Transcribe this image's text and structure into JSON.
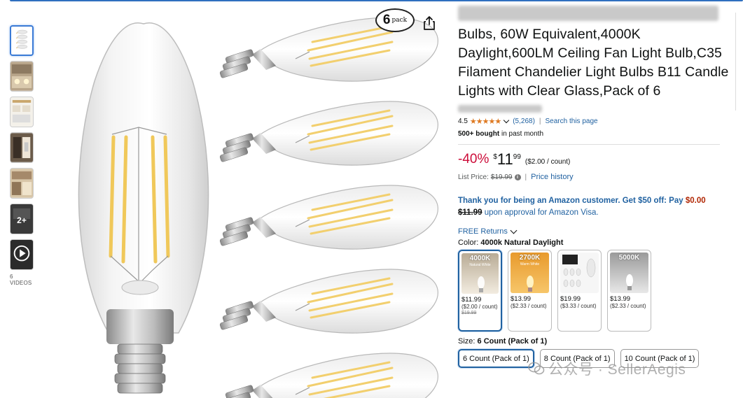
{
  "product": {
    "title": "Bulbs, 60W Equivalent,4000K Daylight,600LM Ceiling Fan Light Bulb,C35 Filament Chandelier Light Bulbs B11 Candle Lights with Clear Glass,Pack of 6",
    "rating_value": "4.5",
    "rating_stars": "★★★★★",
    "rating_count": "(5,268)",
    "search_page_link": "Search this page",
    "bought_count": "500+ bought",
    "bought_suffix": " in past month",
    "discount": "-40%",
    "currency": "$",
    "price_whole": "11",
    "price_fraction": "99",
    "unit_price": "($2.00 / count)",
    "list_price_label": "List Price:",
    "list_price": "$19.99",
    "price_history_link": "Price history",
    "pack_badge_number": "6",
    "pack_badge_text": "pack"
  },
  "promo": {
    "text_bold": "Thank you for being an Amazon customer. Get $50 off: Pay",
    "pay_amount": "$0.00",
    "original": "$11.99",
    "suffix": " upon approval for Amazon Visa."
  },
  "returns": {
    "label": "FREE Returns"
  },
  "color": {
    "label": "Color:",
    "selected": "4000k Natural Daylight",
    "options": [
      {
        "cct": "4000K",
        "sub": "Natural White",
        "price": "$11.99",
        "unit": "($2.00 / count)",
        "strike": "$19.99"
      },
      {
        "cct": "2700K",
        "sub": "Warm White",
        "price": "$13.99",
        "unit": "($2.33 / count)",
        "strike": ""
      },
      {
        "cct": "",
        "sub": "",
        "price": "$19.99",
        "unit": "($3.33 / count)",
        "strike": ""
      },
      {
        "cct": "5000K",
        "sub": "",
        "price": "$13.99",
        "unit": "($2.33 / count)",
        "strike": ""
      }
    ]
  },
  "size": {
    "label": "Size:",
    "selected": "6 Count (Pack of 1)",
    "options": [
      "6 Count (Pack of 1)",
      "8 Count (Pack of 1)",
      "10 Count (Pack of 1)"
    ]
  },
  "thumbnails": {
    "videos_label": "6 VIDEOS",
    "more_label": "2+"
  },
  "watermark": {
    "text": "公众号 · SellerAegis"
  },
  "colors": {
    "link": "#2162a1",
    "discount": "#cc0c39",
    "star": "#de7921",
    "selected_border": "#2162a1",
    "promo_red": "#b12704"
  }
}
